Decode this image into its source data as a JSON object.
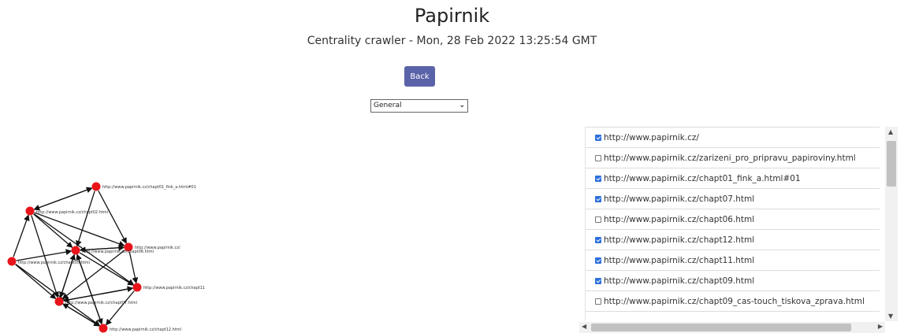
{
  "header": {
    "title": "Papirnik",
    "subtitle": "Centrality crawler - Mon, 28 Feb 2022 13:25:54 GMT"
  },
  "back_label": "Back",
  "view_select": {
    "value": "General"
  },
  "colors": {
    "accent": "#5a63a8",
    "node": "#e8141a",
    "edge": "#111111",
    "checkbox": "#2c6fdc"
  },
  "graph": {
    "node_labels": [
      "http://www.papirnik.cz/chapt01_fink_a.html#01",
      "http://www.papirnik.cz/chapt02.html",
      "http://www.papirnik.cz/chapt06.html",
      "http://www.papirnik.cz/",
      "http://www.papirnik.cz/chapt05.html",
      "http://www.papirnik.cz/chapt11",
      "http://www.papirnik.cz/chapt07.html",
      "http://www.papirnik.cz/chapt12.html"
    ]
  },
  "url_list": [
    {
      "url": "http://www.papirnik.cz/",
      "checked": true
    },
    {
      "url": "http://www.papirnik.cz/zarizeni_pro_pripravu_papiroviny.html",
      "checked": false
    },
    {
      "url": "http://www.papirnik.cz/chapt01_fink_a.html#01",
      "checked": true
    },
    {
      "url": "http://www.papirnik.cz/chapt07.html",
      "checked": true
    },
    {
      "url": "http://www.papirnik.cz/chapt06.html",
      "checked": false
    },
    {
      "url": "http://www.papirnik.cz/chapt12.html",
      "checked": true
    },
    {
      "url": "http://www.papirnik.cz/chapt11.html",
      "checked": true
    },
    {
      "url": "http://www.papirnik.cz/chapt09.html",
      "checked": true
    },
    {
      "url": "http://www.papirnik.cz/chapt09_cas-touch_tiskova_zprava.html",
      "checked": false
    }
  ]
}
